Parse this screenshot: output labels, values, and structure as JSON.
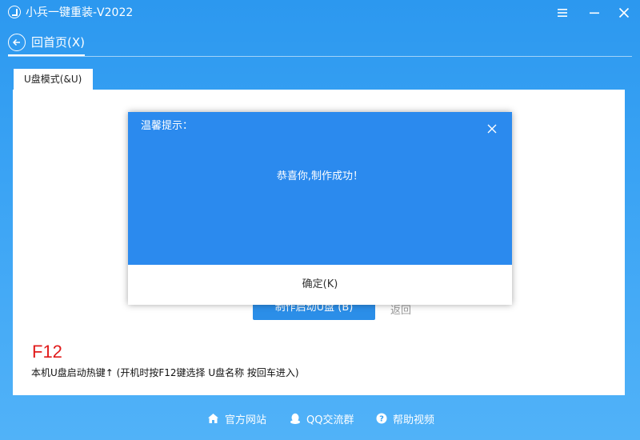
{
  "window": {
    "title": "小兵一键重装-V2022",
    "icons": {
      "logo": "app-logo-icon",
      "menu": "menu-icon",
      "minimize": "minimize-icon",
      "close": "close-icon"
    }
  },
  "nav": {
    "back_label": "回首页(X)",
    "back_icon": "arrow-left-icon"
  },
  "tabs": [
    {
      "label": "U盘模式(&U)",
      "active": true
    }
  ],
  "main": {
    "make_button_label": "制作启动U盘 (B)",
    "return_label": "返回",
    "hotkey": "F12",
    "hotkey_desc": "本机U盘启动热键↑ (开机时按F12键选择 U盘名称 按回车进入)"
  },
  "dialog": {
    "title": "温馨提示：",
    "message": "恭喜你,制作成功！",
    "ok_label": "确定(K)",
    "close_icon": "close-icon"
  },
  "footer": {
    "links": [
      {
        "label": "官方网站",
        "icon": "home-icon"
      },
      {
        "label": "QQ交流群",
        "icon": "qq-penguin-icon"
      },
      {
        "label": "帮助视频",
        "icon": "help-icon"
      }
    ]
  },
  "colors": {
    "title_bar": "#2c98ef",
    "dialog_header": "#2b8aee",
    "button_blue": "#2b8ee8",
    "hotkey_red": "#e11b1b"
  }
}
